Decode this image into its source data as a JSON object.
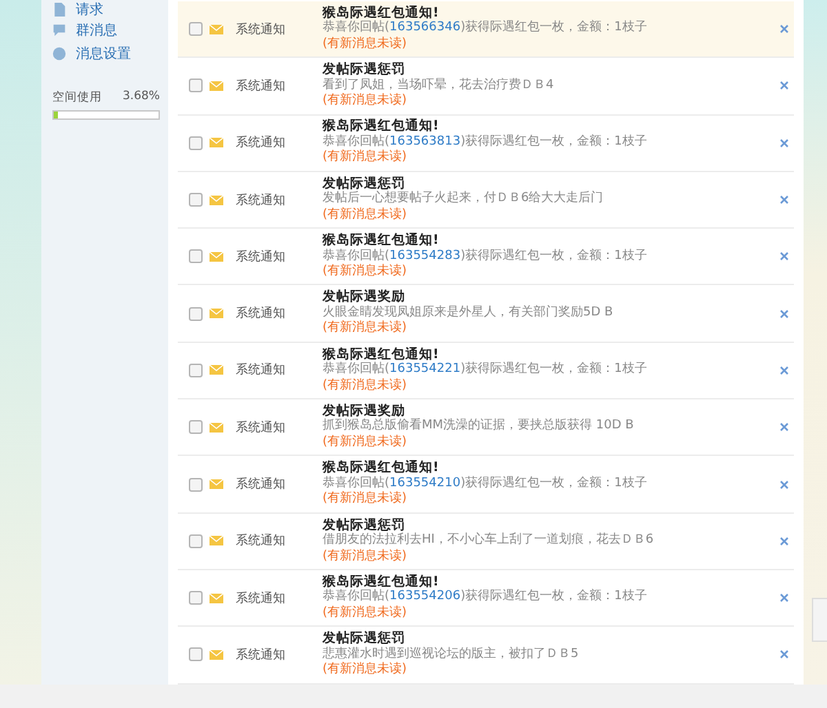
{
  "sidebar": {
    "items": [
      {
        "label": "请求"
      },
      {
        "label": "群消息"
      },
      {
        "label": "消息设置"
      }
    ],
    "storage": {
      "label": "空间使用",
      "reading": "3.68%",
      "level": 0.04
    }
  },
  "messages": [
    {
      "kind": "packet",
      "highlighted": true,
      "checked": false,
      "sender": "系统通知",
      "title": "猴岛际遇红包通知!",
      "before": "恭喜你回帖(",
      "link": "163566346",
      "after": ")获得际遇红包一枚，金额：1枝子",
      "status": "(有新消息未读)"
    },
    {
      "kind": "plain",
      "highlighted": false,
      "checked": false,
      "sender": "系统通知",
      "title": "发帖际遇惩罚",
      "body": "看到了凤姐，当场吓晕，花去治疗费ＤＢ4",
      "status": "(有新消息未读)"
    },
    {
      "kind": "packet",
      "highlighted": false,
      "checked": false,
      "sender": "系统通知",
      "title": "猴岛际遇红包通知!",
      "before": "恭喜你回帖(",
      "link": "163563813",
      "after": ")获得际遇红包一枚，金额：1枝子",
      "status": "(有新消息未读)"
    },
    {
      "kind": "plain",
      "highlighted": false,
      "checked": false,
      "sender": "系统通知",
      "title": "发帖际遇惩罚",
      "body": "发帖后一心想要帖子火起来，付ＤＢ6给大大走后门",
      "status": "(有新消息未读)"
    },
    {
      "kind": "packet",
      "highlighted": false,
      "checked": false,
      "sender": "系统通知",
      "title": "猴岛际遇红包通知!",
      "before": "恭喜你回帖(",
      "link": "163554283",
      "after": ")获得际遇红包一枚，金额：1枝子",
      "status": "(有新消息未读)"
    },
    {
      "kind": "plain",
      "highlighted": false,
      "checked": false,
      "sender": "系统通知",
      "title": "发帖际遇奖励",
      "body": "火眼金睛发现凤姐原来是外星人，有关部门奖励5D B",
      "status": "(有新消息未读)"
    },
    {
      "kind": "packet",
      "highlighted": false,
      "checked": false,
      "sender": "系统通知",
      "title": "猴岛际遇红包通知!",
      "before": "恭喜你回帖(",
      "link": "163554221",
      "after": ")获得际遇红包一枚，金额：1枝子",
      "status": "(有新消息未读)"
    },
    {
      "kind": "plain",
      "highlighted": false,
      "checked": false,
      "sender": "系统通知",
      "title": "发帖际遇奖励",
      "body": "抓到猴岛总版偷看MM洗澡的证据，要挟总版获得 10D B",
      "status": "(有新消息未读)"
    },
    {
      "kind": "packet",
      "highlighted": false,
      "checked": false,
      "sender": "系统通知",
      "title": "猴岛际遇红包通知!",
      "before": "恭喜你回帖(",
      "link": "163554210",
      "after": ")获得际遇红包一枚，金额：1枝子",
      "status": "(有新消息未读)"
    },
    {
      "kind": "plain",
      "highlighted": false,
      "checked": false,
      "sender": "系统通知",
      "title": "发帖际遇惩罚",
      "body": "借朋友的法拉利去HI，不小心车上刮了一道划痕，花去ＤＢ6",
      "status": "(有新消息未读)"
    },
    {
      "kind": "packet",
      "highlighted": false,
      "checked": false,
      "sender": "系统通知",
      "title": "猴岛际遇红包通知!",
      "before": "恭喜你回帖(",
      "link": "163554206",
      "after": ")获得际遇红包一枚，金额：1枝子",
      "status": "(有新消息未读)"
    },
    {
      "kind": "plain",
      "highlighted": false,
      "checked": false,
      "sender": "系统通知",
      "title": "发帖际遇惩罚",
      "body": "悲惠灌水时遇到巡视论坛的版主，被扣了ＤＢ5",
      "status": "(有新消息未读)"
    }
  ]
}
